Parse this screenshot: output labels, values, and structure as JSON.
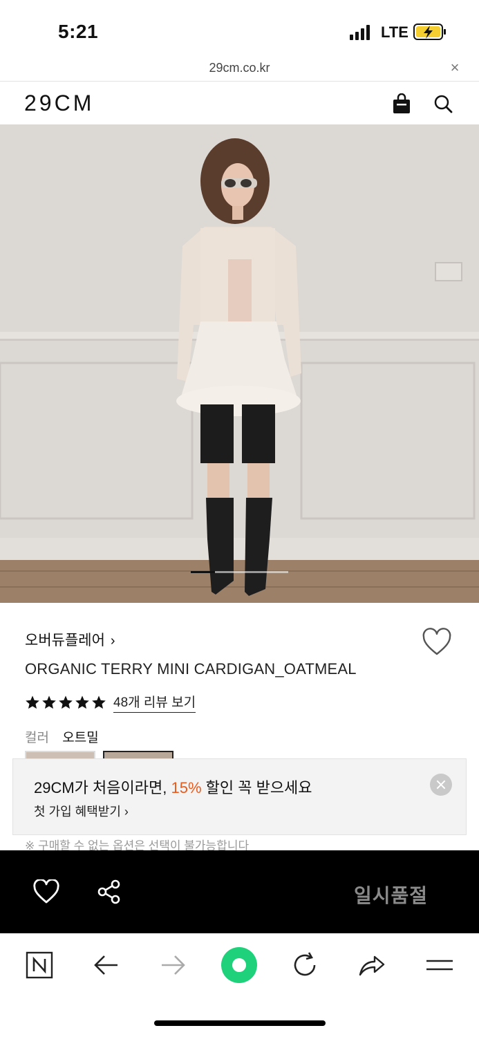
{
  "status_bar": {
    "time": "5:21",
    "network": "LTE"
  },
  "browser": {
    "url": "29cm.co.kr",
    "close_glyph": "×"
  },
  "header": {
    "logo": "29CM",
    "icons": [
      "shopping-bag-icon",
      "search-icon"
    ]
  },
  "carousel": {
    "total": 4,
    "active_index": 1
  },
  "product": {
    "brand": "오버듀플레어",
    "brand_chevron": "›",
    "name": "ORGANIC TERRY MINI CARDIGAN_OATMEAL",
    "rating": 5,
    "review_link": "48개 리뷰 보기",
    "color_label": "컬러",
    "color_value": "오트밀"
  },
  "promo": {
    "title_pre": "29CM가 처음이라면, ",
    "title_pct": "15%",
    "title_post": " 할인 꼭 받으세요",
    "subtitle": "첫 가입 혜택받기 ›",
    "accent_color": "#ea5a1c"
  },
  "notice": "※ 구매할 수 없는 옵션은 선택이 불가능합니다",
  "action_bar": {
    "soldout_label": "일시품절"
  },
  "browser_toolbar": {
    "icons": [
      "naver-n-icon",
      "back-arrow-icon",
      "forward-arrow-icon",
      "green-home-icon",
      "reload-icon",
      "share-icon",
      "menu-icon"
    ],
    "home_color": "#1fd17a"
  }
}
